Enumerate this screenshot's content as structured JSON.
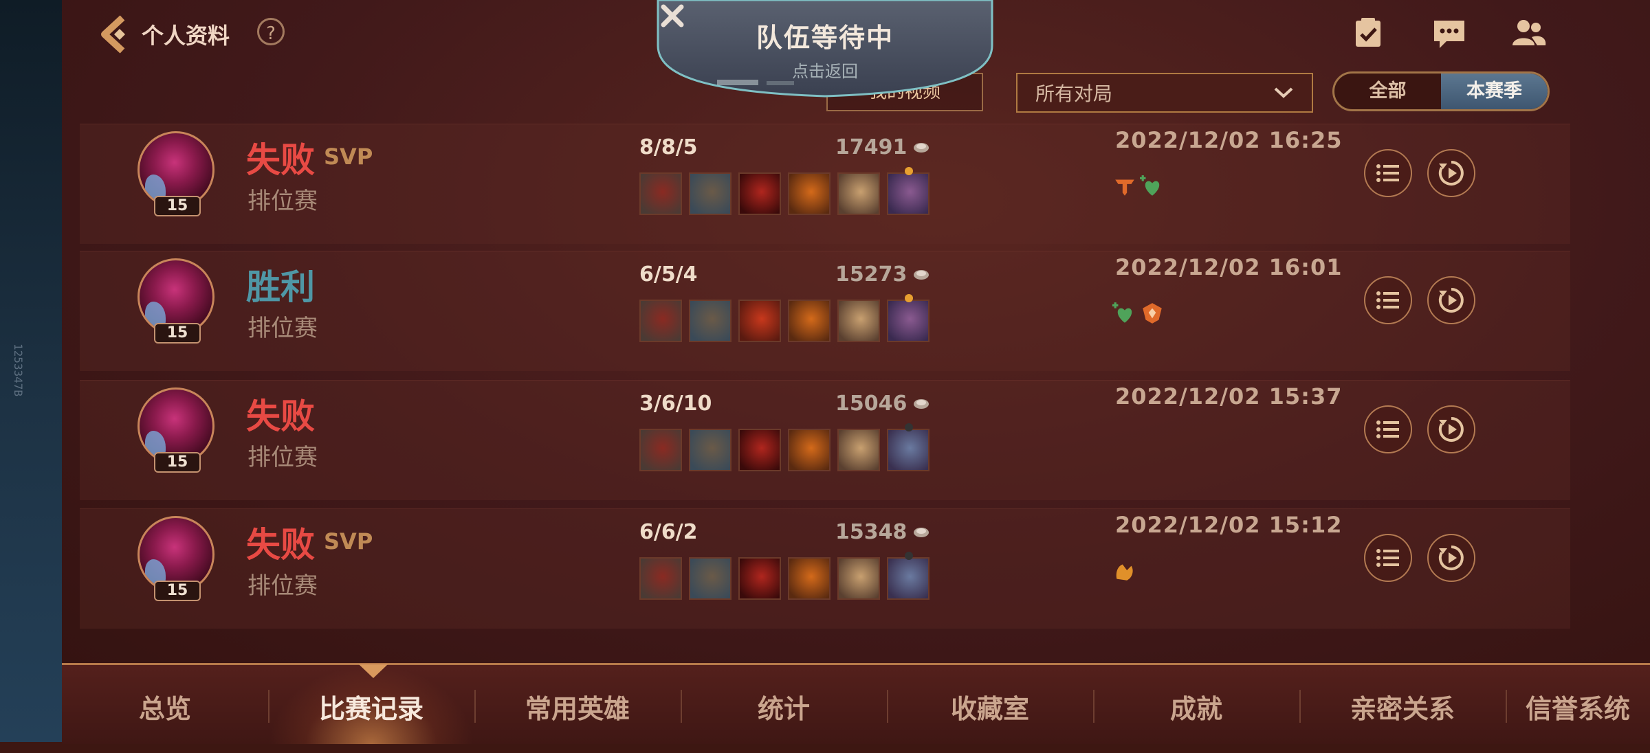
{
  "left_strip": {
    "vertical_text": "1253347B"
  },
  "header": {
    "back_label": "个人资料",
    "help_label": "?"
  },
  "team_popup": {
    "title": "队伍等待中",
    "subtitle": "点击返回"
  },
  "filters": {
    "video_button": "我的视频",
    "dropdown_value": "所有对局",
    "segment_all": "全部",
    "segment_season": "本赛季",
    "segment_selected": "本赛季"
  },
  "matches": [
    {
      "level": "15",
      "result": "失败",
      "result_type": "lose",
      "svp": "SVP",
      "mode": "排位赛",
      "kda": "8/8/5",
      "gold": "17491",
      "time": "2022/12/02 16:25",
      "badges": [
        "triple-kill-badge",
        "heal-badge"
      ]
    },
    {
      "level": "15",
      "result": "胜利",
      "result_type": "win",
      "svp": "",
      "mode": "排位赛",
      "kda": "6/5/4",
      "gold": "15273",
      "time": "2022/12/02 16:01",
      "badges": [
        "heal-badge",
        "shield-badge"
      ]
    },
    {
      "level": "15",
      "result": "失败",
      "result_type": "lose",
      "svp": "",
      "mode": "排位赛",
      "kda": "3/6/10",
      "gold": "15046",
      "time": "2022/12/02 15:37",
      "badges": []
    },
    {
      "level": "15",
      "result": "失败",
      "result_type": "lose",
      "svp": "SVP",
      "mode": "排位赛",
      "kda": "6/6/2",
      "gold": "15348",
      "time": "2022/12/02 15:12",
      "badges": [
        "hand-badge"
      ]
    }
  ],
  "nav": {
    "items": [
      "总览",
      "比赛记录",
      "常用英雄",
      "统计",
      "收藏室",
      "成就",
      "亲密关系",
      "信誉系统"
    ],
    "active": "比赛记录"
  },
  "colors": {
    "lose": "#e84a44",
    "win": "#4f97a6",
    "accent_gold": "#b07a42",
    "background": "#3d1712"
  }
}
